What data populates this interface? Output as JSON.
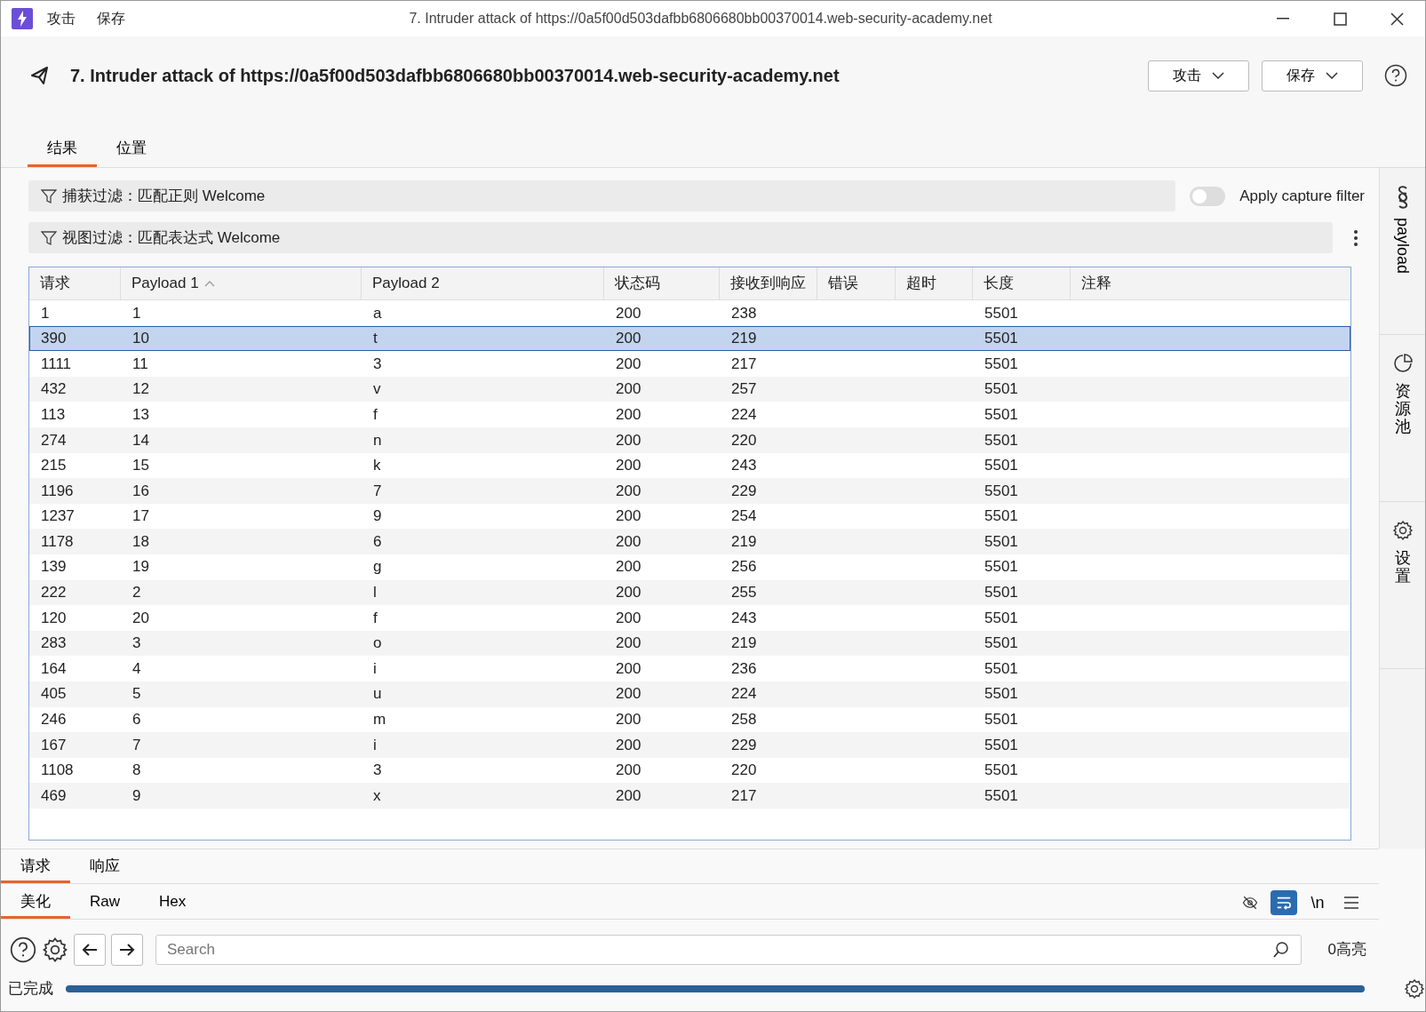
{
  "window": {
    "menu": [
      "攻击",
      "保存"
    ],
    "title": "7. Intruder attack of https://0a5f00d503dafbb6806680bb00370014.web-security-academy.net"
  },
  "header": {
    "title": "7. Intruder attack of https://0a5f00d503dafbb6806680bb00370014.web-security-academy.net",
    "buttons": [
      "攻击",
      "保存"
    ]
  },
  "tabs": [
    {
      "label": "结果",
      "selected": true
    },
    {
      "label": "位置",
      "selected": false
    }
  ],
  "capture_filter": {
    "text": "捕获过滤：匹配正则 Welcome",
    "toggle_label": "Apply capture filter",
    "on": false
  },
  "view_filter": {
    "text": "视图过滤：匹配表达式 Welcome"
  },
  "table": {
    "columns": [
      {
        "label": "请求"
      },
      {
        "label": "Payload 1",
        "sorted": true
      },
      {
        "label": "Payload 2"
      },
      {
        "label": "状态码"
      },
      {
        "label": "接收到响应"
      },
      {
        "label": "错误"
      },
      {
        "label": "超时"
      },
      {
        "label": "长度"
      },
      {
        "label": "注释"
      }
    ],
    "rows": [
      {
        "cells": [
          "1",
          "1",
          "a",
          "200",
          "238",
          "",
          "",
          "5501",
          ""
        ],
        "selected": false
      },
      {
        "cells": [
          "390",
          "10",
          "t",
          "200",
          "219",
          "",
          "",
          "5501",
          ""
        ],
        "selected": true
      },
      {
        "cells": [
          "1111",
          "11",
          "3",
          "200",
          "217",
          "",
          "",
          "5501",
          ""
        ],
        "selected": false
      },
      {
        "cells": [
          "432",
          "12",
          "v",
          "200",
          "257",
          "",
          "",
          "5501",
          ""
        ],
        "selected": false
      },
      {
        "cells": [
          "113",
          "13",
          "f",
          "200",
          "224",
          "",
          "",
          "5501",
          ""
        ],
        "selected": false
      },
      {
        "cells": [
          "274",
          "14",
          "n",
          "200",
          "220",
          "",
          "",
          "5501",
          ""
        ],
        "selected": false
      },
      {
        "cells": [
          "215",
          "15",
          "k",
          "200",
          "243",
          "",
          "",
          "5501",
          ""
        ],
        "selected": false
      },
      {
        "cells": [
          "1196",
          "16",
          "7",
          "200",
          "229",
          "",
          "",
          "5501",
          ""
        ],
        "selected": false
      },
      {
        "cells": [
          "1237",
          "17",
          "9",
          "200",
          "254",
          "",
          "",
          "5501",
          ""
        ],
        "selected": false
      },
      {
        "cells": [
          "1178",
          "18",
          "6",
          "200",
          "219",
          "",
          "",
          "5501",
          ""
        ],
        "selected": false
      },
      {
        "cells": [
          "139",
          "19",
          "g",
          "200",
          "256",
          "",
          "",
          "5501",
          ""
        ],
        "selected": false
      },
      {
        "cells": [
          "222",
          "2",
          "l",
          "200",
          "255",
          "",
          "",
          "5501",
          ""
        ],
        "selected": false
      },
      {
        "cells": [
          "120",
          "20",
          "f",
          "200",
          "243",
          "",
          "",
          "5501",
          ""
        ],
        "selected": false
      },
      {
        "cells": [
          "283",
          "3",
          "o",
          "200",
          "219",
          "",
          "",
          "5501",
          ""
        ],
        "selected": false
      },
      {
        "cells": [
          "164",
          "4",
          "i",
          "200",
          "236",
          "",
          "",
          "5501",
          ""
        ],
        "selected": false
      },
      {
        "cells": [
          "405",
          "5",
          "u",
          "200",
          "224",
          "",
          "",
          "5501",
          ""
        ],
        "selected": false
      },
      {
        "cells": [
          "246",
          "6",
          "m",
          "200",
          "258",
          "",
          "",
          "5501",
          ""
        ],
        "selected": false
      },
      {
        "cells": [
          "167",
          "7",
          "i",
          "200",
          "229",
          "",
          "",
          "5501",
          ""
        ],
        "selected": false
      },
      {
        "cells": [
          "1108",
          "8",
          "3",
          "200",
          "220",
          "",
          "",
          "5501",
          ""
        ],
        "selected": false
      },
      {
        "cells": [
          "469",
          "9",
          "x",
          "200",
          "217",
          "",
          "",
          "5501",
          ""
        ],
        "selected": false
      }
    ]
  },
  "sidebar": {
    "items": [
      {
        "kind": "payload",
        "label": "payload"
      },
      {
        "kind": "pool",
        "label": "资源池"
      },
      {
        "kind": "settings",
        "label": "设置"
      }
    ]
  },
  "detail_tabs": [
    {
      "label": "请求",
      "selected": true
    },
    {
      "label": "响应",
      "selected": false
    }
  ],
  "view_tabs": [
    {
      "label": "美化",
      "selected": true
    },
    {
      "label": "Raw",
      "selected": false
    },
    {
      "label": "Hex",
      "selected": false
    }
  ],
  "view_tools": [
    {
      "kind": "hide",
      "on": false
    },
    {
      "kind": "wrap",
      "on": true
    },
    {
      "kind": "newline",
      "text": "\\n",
      "on": false
    },
    {
      "kind": "menu",
      "on": false
    }
  ],
  "search": {
    "placeholder": "Search",
    "highlights": "0高亮"
  },
  "status": {
    "text": "已完成",
    "level": 1
  }
}
